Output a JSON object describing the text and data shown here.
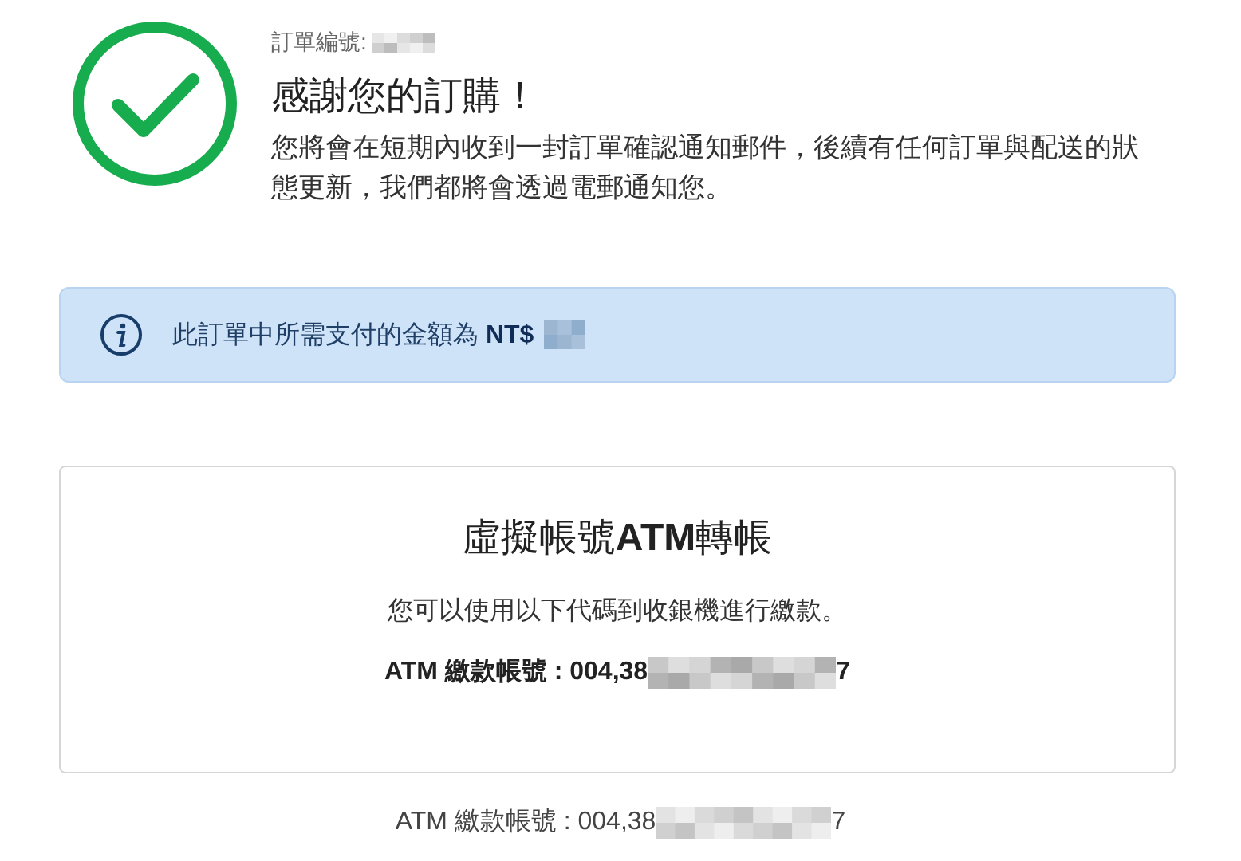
{
  "order": {
    "label": "訂單編號:"
  },
  "title": "感謝您的訂購！",
  "message": "您將會在短期內收到一封訂單確認通知郵件，後續有任何訂單與配送的狀態更新，我們都將會透過電郵通知您。",
  "notice": {
    "text": "此訂單中所需支付的金額為 **NT$**"
  },
  "payment_card": {
    "title": "虛擬帳號**ATM**轉帳",
    "description": "您可以使用以下代碼到收銀機進行繳款。",
    "account_prefix": "ATM 繳款帳號 : 004,38",
    "account_suffix": "7"
  },
  "footer_account": {
    "prefix": "ATM 繳款帳號 : 004,38",
    "suffix": "7"
  }
}
